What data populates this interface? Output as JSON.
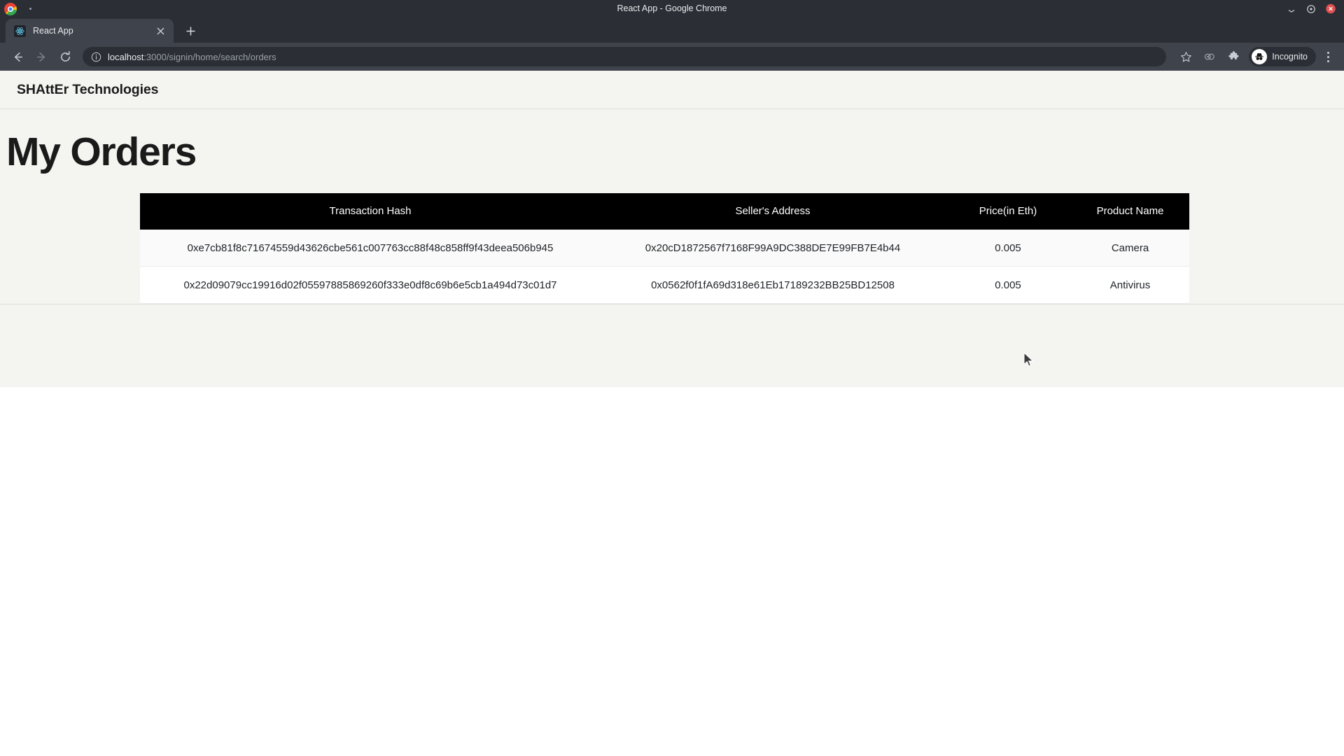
{
  "window": {
    "title": "React App - Google Chrome",
    "minimize_icon": "minimize-icon",
    "maximize_icon": "maximize-icon",
    "close_icon": "close-icon"
  },
  "tabstrip": {
    "tabs": [
      {
        "title": "React App",
        "favicon": "react-logo-icon",
        "close_icon": "tab-close-icon"
      }
    ],
    "new_tab_icon": "plus-icon"
  },
  "toolbar": {
    "back_icon": "back-arrow-icon",
    "forward_icon": "forward-arrow-icon",
    "reload_icon": "reload-icon",
    "site_info_icon": "info-circle-icon",
    "url_host": "localhost",
    "url_path": ":3000/signin/home/search/orders",
    "url_full": "localhost:3000/signin/home/search/orders",
    "bookmark_icon": "star-icon",
    "sharing_icon": "media-share-icon",
    "extensions_icon": "puzzle-piece-icon",
    "incognito_label": "Incognito",
    "incognito_icon": "incognito-hat-icon",
    "menu_icon": "three-dot-menu-icon"
  },
  "page": {
    "brand": "SHAttEr Technologies",
    "heading": "My Orders",
    "table": {
      "columns": [
        "Transaction Hash",
        "Seller's Address",
        "Price(in Eth)",
        "Product Name"
      ],
      "rows": [
        {
          "hash": "0xe7cb81f8c71674559d43626cbe561c007763cc88f48c858ff9f43deea506b945",
          "address": "0x20cD1872567f7168F99A9DC388DE7E99FB7E4b44",
          "price": "0.005",
          "product": "Camera"
        },
        {
          "hash": "0x22d09079cc19916d02f05597885869260f333e0df8c69b6e5cb1a494d73c01d7",
          "address": "0x0562f0f1fA69d318e61Eb17189232BB25BD12508",
          "price": "0.005",
          "product": "Antivirus"
        }
      ]
    }
  },
  "colors": {
    "chrome_frame": "#2b2f35",
    "chrome_toolbar": "#3f444c",
    "page_background": "#f4f4f0",
    "table_header_bg": "#000000",
    "table_header_fg": "#ffffff",
    "row_striped_bg": "#fafafa",
    "row_plain_bg": "#ffffff",
    "text_primary": "#1a1a1a"
  }
}
